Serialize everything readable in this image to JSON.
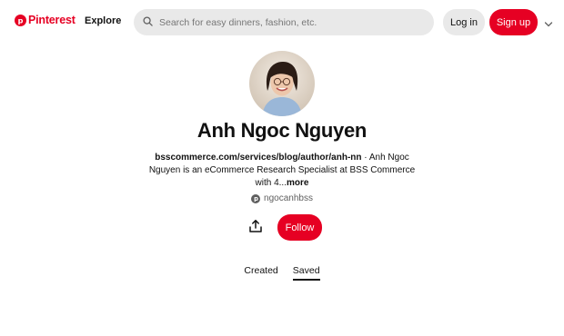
{
  "header": {
    "logo_text": "Pinterest",
    "explore_label": "Explore",
    "search_placeholder": "Search for easy dinners, fashion, etc.",
    "login_label": "Log in",
    "signup_label": "Sign up",
    "brand_color": "#e60023"
  },
  "profile": {
    "name": "Anh Ngoc Nguyen",
    "bio_link": "bsscommerce.com/services/blog/author/anh-nn",
    "bio_text": " · Anh Ngoc Nguyen is an eCommerce Research Specialist at BSS Commerce with 4...",
    "bio_more": "more",
    "handle": "ngocanhbss",
    "follow_label": "Follow"
  },
  "tabs": [
    {
      "label": "Created",
      "active": false
    },
    {
      "label": "Saved",
      "active": true
    }
  ],
  "icons": {
    "logo": "pinterest-logo-icon",
    "search": "search-icon",
    "chevron": "chevron-down-icon",
    "share": "share-icon",
    "handle": "pinterest-icon"
  }
}
